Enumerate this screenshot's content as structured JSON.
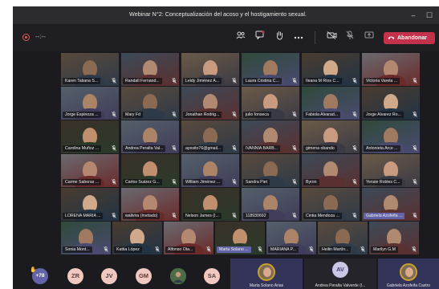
{
  "window": {
    "title": "Webinar N°2: Conceptualización del acoso y el hostigamiento sexual.",
    "minimize_glyph": "–",
    "maximize_glyph": "☐"
  },
  "toolbar": {
    "timer": "--:--",
    "leave_label": "Abandonar",
    "accent": "#c4314b",
    "icons": [
      "participants-icon",
      "chat-icon",
      "raise-hand-icon",
      "more-options-icon",
      "camera-off-icon",
      "mic-off-icon",
      "share-screen-icon",
      "phone-icon"
    ]
  },
  "grid": {
    "highlight_color": "#6264a7",
    "tiles": [
      [
        "Karen Tatiana S...",
        "Randall Fernand...",
        "Leidy Jiménez A...",
        "Laura Cristina C...",
        "Ileana M Ríos C...",
        "Victoria Varela ..."
      ],
      [
        "Jorge Espinoza ...",
        "Mary Fd",
        "Jonathan Rodrig...",
        "julio fonseca",
        "Fabiola Alvarad...",
        "Jorge Alvarez Ro..."
      ],
      [
        "Carolina Muñoz ...",
        "Andrea Peralta Val...",
        "ayesito76@gmail...",
        "IVANNIA BARB...",
        "gimena obando",
        "Antonieta Arce ..."
      ],
      [
        "Carme Saberas ...",
        "Carlos Suárez G...",
        "William Jiménez ...",
        "Sandra Piet",
        "Byron",
        "Yensie Robles C..."
      ],
      [
        "LORENA MARIA ...",
        "wallvira (Invitado)",
        "Nelson James (I...",
        "118930692",
        "Cintia Mendoza ...",
        "Gabriela Azofeifa ..."
      ],
      [
        "Sonia Mont...",
        "Kattia López",
        "Alfonso Ota...",
        "Marta Solano ...",
        "MARIANA P...",
        "Heilin Martín...",
        "Marilyn G.M"
      ]
    ]
  },
  "bottom": {
    "more_count": "+78",
    "initials": [
      "ZR",
      "JV",
      "GM",
      "SA"
    ],
    "cards": [
      {
        "name": "Marta Solano Arias"
      },
      {
        "name": "Andrea Peralta Valverde (I..."
      },
      {
        "name": "Gabriela Azofeifa Castro"
      }
    ],
    "center_initials": "AV"
  }
}
